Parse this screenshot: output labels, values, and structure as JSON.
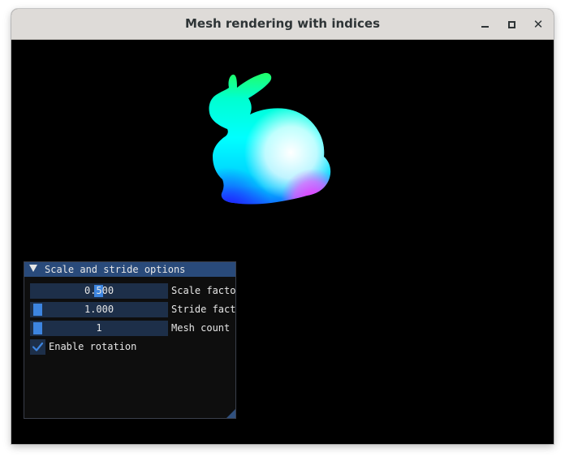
{
  "window": {
    "title": "Mesh rendering with indices",
    "controls": {
      "minimize_icon": "minimize-icon",
      "maximize_icon": "maximize-icon",
      "close_icon": "close-icon",
      "close_glyph": "✕"
    }
  },
  "scene": {
    "background": "#000000",
    "model": "bunny-mesh"
  },
  "panel": {
    "title": "Scale and stride options",
    "collapse_icon": "triangle-down-icon",
    "sliders": [
      {
        "label": "Scale factor",
        "value": "0.500",
        "fraction": 0.5
      },
      {
        "label": "Stride factor",
        "value": "1.000",
        "fraction": 0.0
      },
      {
        "label": "Mesh count",
        "value": "1",
        "fraction": 0.0
      }
    ],
    "checkbox": {
      "label": "Enable rotation",
      "checked": true
    },
    "colors": {
      "title_bg": "#294a7a",
      "frame_bg": "#1d2f49",
      "grab": "#3d85e0",
      "text": "#e6e6e6"
    }
  }
}
